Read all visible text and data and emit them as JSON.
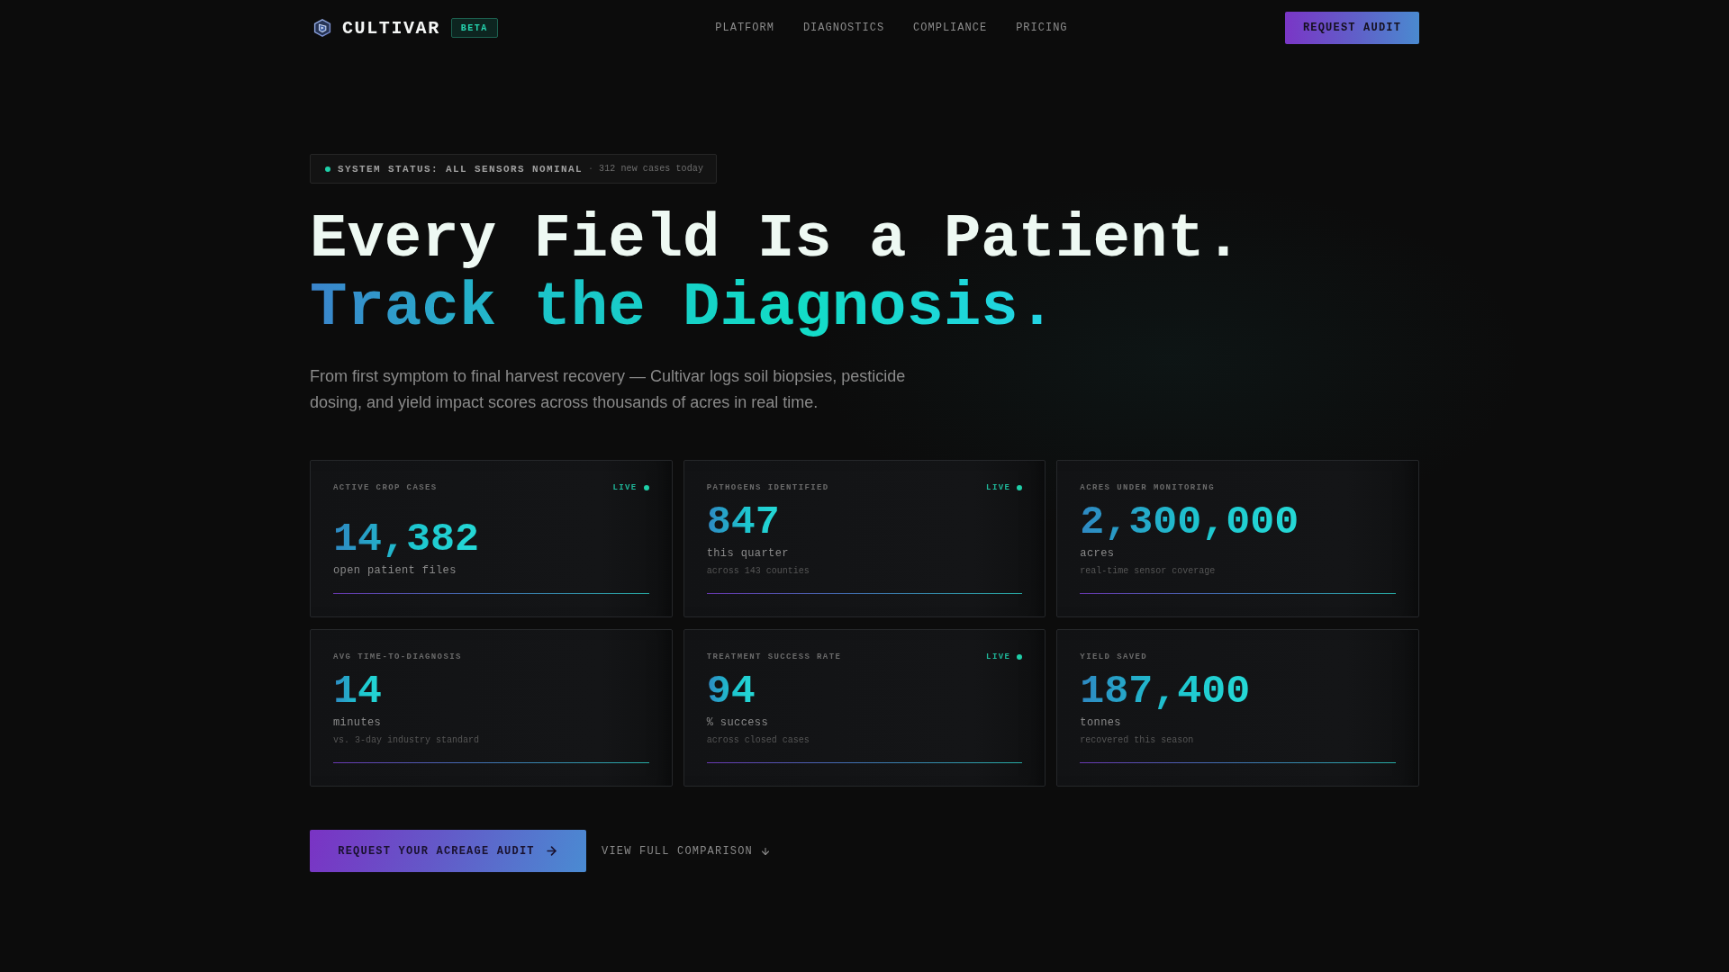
{
  "nav": {
    "brand": "CULTIVAR",
    "badge": "BETA",
    "links": [
      "PLATFORM",
      "DIAGNOSTICS",
      "COMPLIANCE",
      "PRICING"
    ],
    "button": "REQUEST AUDIT"
  },
  "status": {
    "label": "SYSTEM STATUS: ALL SENSORS NOMINAL",
    "separator": "·",
    "note": "312 new cases today"
  },
  "hero": {
    "title_line_1": "Every Field Is a Patient.",
    "title_line_2": "Track the Diagnosis.",
    "description": "From first symptom to final harvest recovery — Cultivar logs soil biopsies, pesticide dosing, and yield impact scores across thousands of acres in real time."
  },
  "stats": [
    {
      "label": "ACTIVE CROP CASES",
      "badge": "LIVE",
      "value": "14,382",
      "unit": "open patient files"
    },
    {
      "label": "PATHOGENS IDENTIFIED",
      "badge": "LIVE",
      "value": "847",
      "unit": "this quarter",
      "note": "across 143 counties"
    },
    {
      "label": "ACRES UNDER MONITORING",
      "value": "2,300,000",
      "unit": "acres",
      "note": "real-time sensor coverage"
    },
    {
      "label": "AVG TIME-TO-DIAGNOSIS",
      "value": "14",
      "unit": "minutes",
      "note": "vs. 3-day industry standard"
    },
    {
      "label": "TREATMENT SUCCESS RATE",
      "badge": "LIVE",
      "value": "94",
      "unit": "% success",
      "note": "across closed cases"
    },
    {
      "label": "YIELD SAVED",
      "value": "187,400",
      "unit": "tonnes",
      "note": "recovered this season"
    }
  ],
  "actions": {
    "primary": "REQUEST YOUR ACREAGE AUDIT",
    "secondary": "VIEW FULL COMPARISON"
  }
}
